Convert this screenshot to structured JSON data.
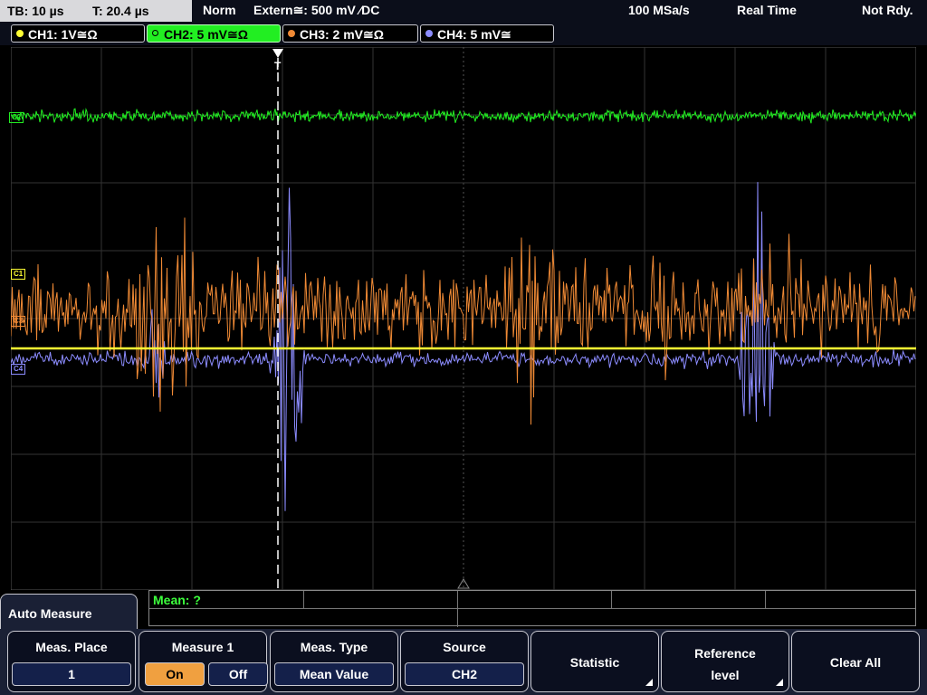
{
  "status_bar": {
    "timebase": "TB: 10 µs",
    "trigger_time": "T: 20.4 µs",
    "mode": "Norm",
    "trigger_source": "Extern≅: 500 mV ⁄DC",
    "sample_rate": "100 MSa/s",
    "acq_mode": "Real Time",
    "trigger_state": "Not Rdy."
  },
  "channels": [
    {
      "label": "CH1: 1V≅Ω",
      "color": "#ffff33",
      "active": false
    },
    {
      "label": "CH2: 5 mV≅Ω",
      "color": "#22ee22",
      "active": true
    },
    {
      "label": "CH3: 2 mV≅Ω",
      "color": "#f08a35",
      "active": false
    },
    {
      "label": "CH4: 5 mV≅",
      "color": "#8c8cff",
      "active": false
    }
  ],
  "markers": {
    "c2": "C2",
    "c1": "C1",
    "c3": "C3",
    "c4": "C4",
    "trigger": "T"
  },
  "measurement": {
    "mean_label": "Mean: ?"
  },
  "panel": {
    "title": "Auto Measure"
  },
  "softkeys": {
    "meas_place": {
      "caption": "Meas. Place",
      "value": "1"
    },
    "measure1": {
      "caption": "Measure 1",
      "on": "On",
      "off": "Off"
    },
    "meas_type": {
      "caption": "Meas. Type",
      "value": "Mean Value"
    },
    "source": {
      "caption": "Source",
      "value": "CH2"
    },
    "statistic": {
      "caption": "Statistic"
    },
    "reference_level": {
      "line1": "Reference",
      "line2": "level"
    },
    "clear_all": {
      "caption": "Clear All"
    }
  },
  "colors": {
    "grid": "#3a3a3a",
    "ch2": "#22ee22",
    "ch1": "#ffff33",
    "ch3": "#f08a35",
    "ch4": "#8c8cff"
  }
}
